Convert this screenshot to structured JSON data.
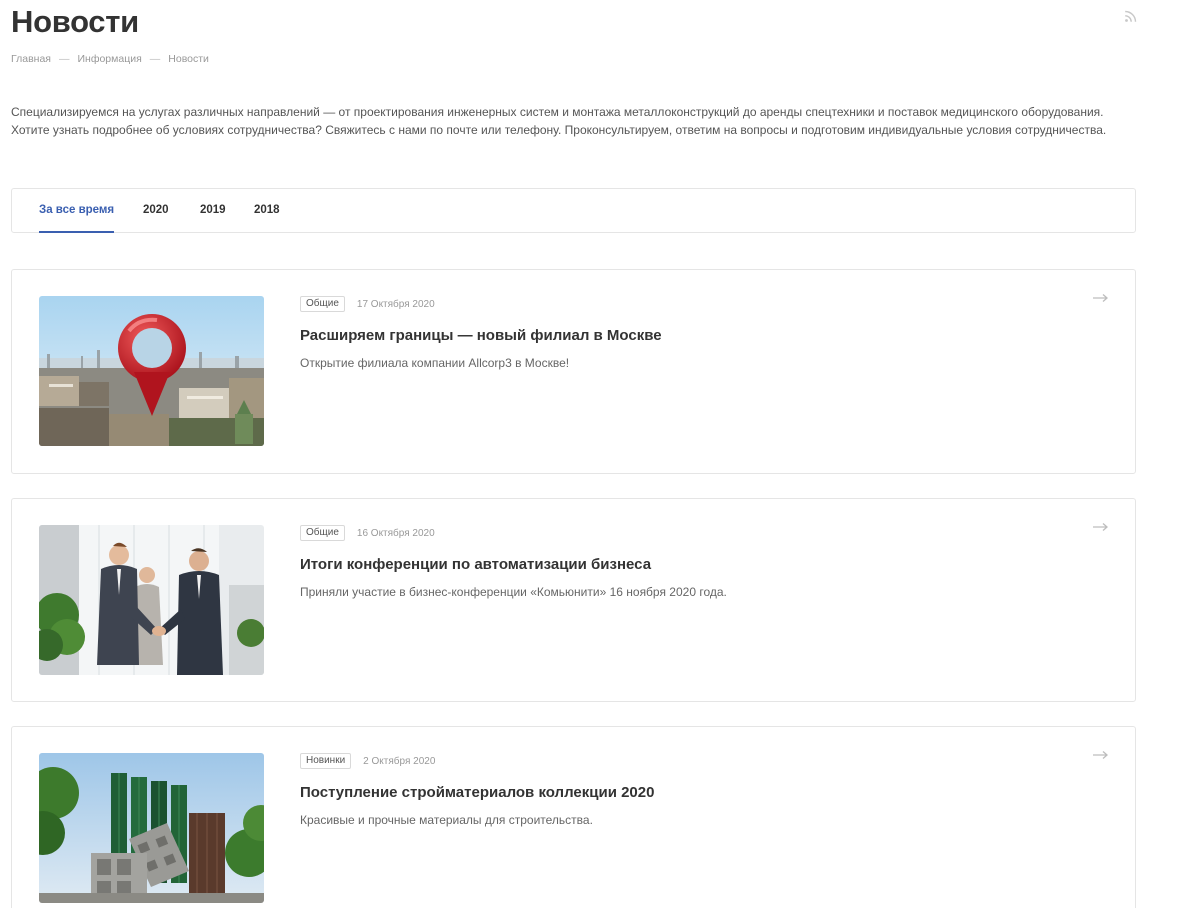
{
  "page": {
    "title": "Новости",
    "icons": {
      "rss": "rss-icon",
      "arrow": "arrow-right-icon"
    }
  },
  "breadcrumb": {
    "items": [
      "Главная",
      "Информация",
      "Новости"
    ],
    "separator": "—"
  },
  "intro": "Специализируемся на услугах различных направлений — от проектирования инженерных систем и монтажа металлоконструкций до аренды спецтехники и поставок медицинского оборудования. Хотите узнать подробнее об условиях сотрудничества? Свяжитесь с нами по почте или телефону. Проконсультируем, ответим на вопросы и подготовим индивидуальные условия сотрудничества.",
  "tabs": [
    {
      "label": "За все время",
      "active": true
    },
    {
      "label": "2020",
      "active": false
    },
    {
      "label": "2019",
      "active": false
    },
    {
      "label": "2018",
      "active": false
    }
  ],
  "colors": {
    "accent": "#3a5fb0",
    "border": "#e5e5e5",
    "text": "#333333",
    "muted": "#999999"
  },
  "news": [
    {
      "tag": "Общие",
      "date": "17 Октября 2020",
      "title": "Расширяем границы — новый филиал в Москве",
      "desc": "Открытие филиала компании Allcorp3 в Москве!"
    },
    {
      "tag": "Общие",
      "date": "16 Октября 2020",
      "title": "Итоги конференции по автоматизации бизнеса",
      "desc": "Приняли участие в бизнес-конференции «Комьюнити» 16 ноября 2020 года."
    },
    {
      "tag": "Новинки",
      "date": "2 Октября 2020",
      "title": "Поступление стройматериалов коллекции 2020",
      "desc": "Красивые и прочные материалы для строительства."
    }
  ]
}
